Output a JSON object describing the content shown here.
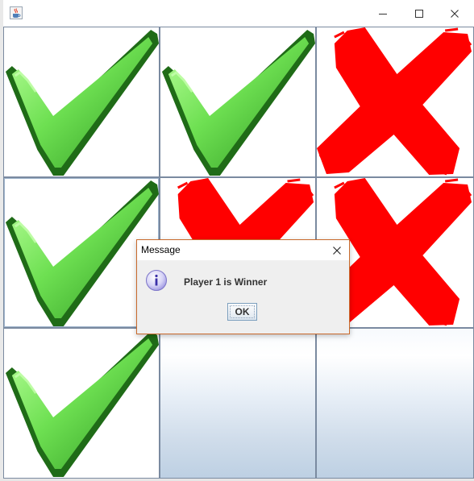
{
  "window": {
    "icon": "java-coffee-cup-icon",
    "controls": [
      "minimize-icon",
      "maximize-icon",
      "close-icon"
    ]
  },
  "board": {
    "rows": [
      [
        "check",
        "check",
        "cross"
      ],
      [
        "check",
        "cross",
        "cross"
      ],
      [
        "check",
        "empty",
        "empty"
      ]
    ],
    "check_color": "#5fd84a",
    "cross_color": "#ff0000"
  },
  "dialog": {
    "title": "Message",
    "message": "Player 1 is Winner",
    "ok_label": "OK",
    "icon": "information-icon"
  }
}
